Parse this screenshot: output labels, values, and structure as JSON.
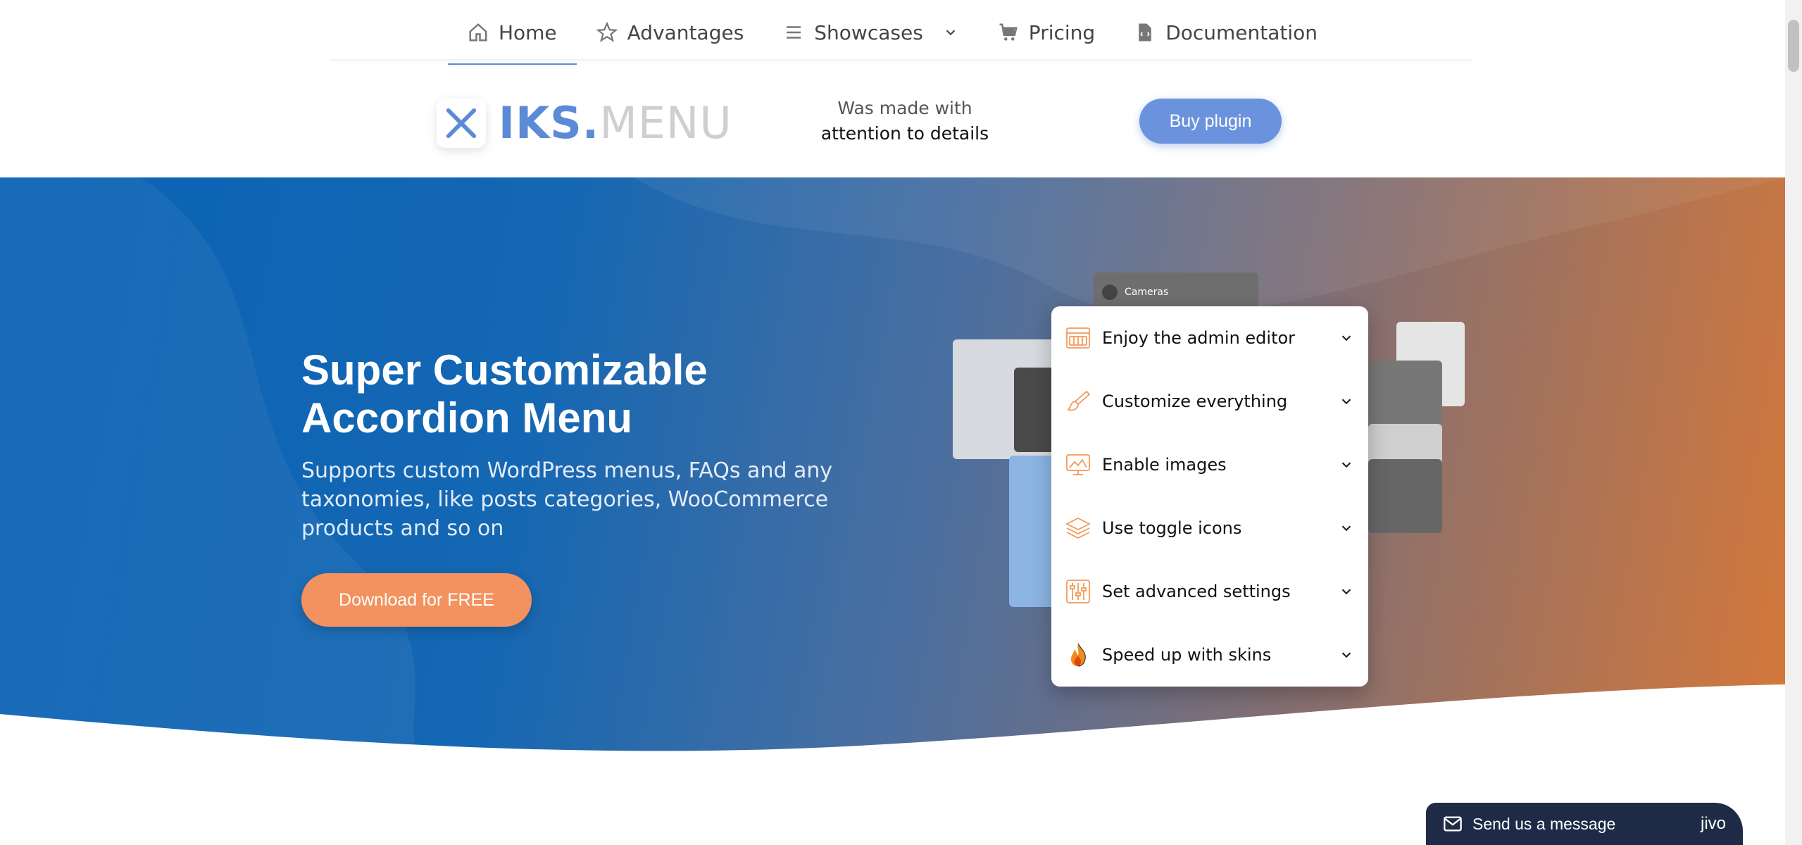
{
  "nav": {
    "items": [
      {
        "label": "Home",
        "icon": "home-icon",
        "active": true
      },
      {
        "label": "Advantages",
        "icon": "star-icon"
      },
      {
        "label": "Showcases",
        "icon": "menu-lines-icon",
        "dropdown": true
      },
      {
        "label": "Pricing",
        "icon": "cart-icon"
      },
      {
        "label": "Documentation",
        "icon": "document-icon"
      }
    ]
  },
  "brand": {
    "logo_bold": "IKS.",
    "logo_light": "MENU",
    "tagline_line1": "Was made with",
    "tagline_line2": "attention to details",
    "buy_label": "Buy plugin"
  },
  "hero": {
    "title_line1": "Super Customizable",
    "title_line2": "Accordion Menu",
    "subtitle": "Supports custom WordPress menus, FAQs and any taxonomies, like posts categories, WooCommerce products and so on",
    "download_label": "Download for FREE",
    "decor_label": "Cameras"
  },
  "accordion": {
    "items": [
      {
        "label": "Enjoy the admin editor",
        "icon": "admin-editor-icon"
      },
      {
        "label": "Customize everything",
        "icon": "brush-icon"
      },
      {
        "label": "Enable images",
        "icon": "image-monitor-icon"
      },
      {
        "label": "Use toggle icons",
        "icon": "layers-icon"
      },
      {
        "label": "Set advanced settings",
        "icon": "sliders-icon"
      },
      {
        "label": "Speed up with skins",
        "icon": "fire-icon"
      }
    ]
  },
  "chat": {
    "label": "Send us a message",
    "brand": "jivo"
  },
  "colors": {
    "accent": "#5b8bd6",
    "button_blue": "#6b93dd",
    "button_orange": "#f3915f",
    "icon_orange": "#f39a5a"
  }
}
